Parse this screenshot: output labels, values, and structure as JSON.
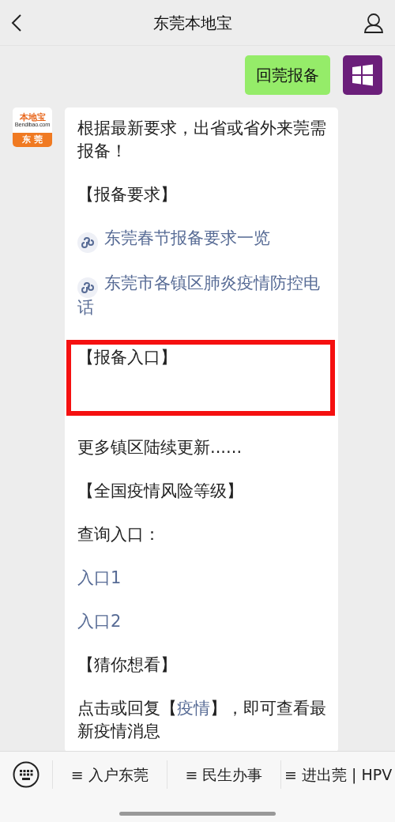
{
  "header": {
    "title": "东莞本地宝"
  },
  "outgoing_message": {
    "text": "回莞报备"
  },
  "incoming_message": {
    "avatar": {
      "brand": "本地宝",
      "site": "Bendibao.com",
      "city": "东 莞"
    },
    "blocks": [
      {
        "kind": "text",
        "parts": [
          {
            "text": "根据最新要求，出省或省外来莞需报备！",
            "link": false
          }
        ]
      },
      {
        "kind": "text",
        "parts": [
          {
            "text": "【报备要求】",
            "link": false
          }
        ]
      },
      {
        "kind": "miniprogram",
        "text": "东莞春节报备要求一览"
      },
      {
        "kind": "miniprogram",
        "text": "东莞市各镇区肺炎疫情防控电话"
      },
      {
        "kind": "boxed",
        "heading": "【报备入口】"
      },
      {
        "kind": "text",
        "parts": [
          {
            "text": "更多镇区陆续更新......",
            "link": false
          }
        ]
      },
      {
        "kind": "text",
        "parts": [
          {
            "text": "【全国疫情风险等级】",
            "link": false
          }
        ]
      },
      {
        "kind": "text",
        "parts": [
          {
            "text": "查询入口：",
            "link": false
          }
        ]
      },
      {
        "kind": "text",
        "parts": [
          {
            "text": "入口1",
            "link": true
          }
        ]
      },
      {
        "kind": "text",
        "parts": [
          {
            "text": "入口2",
            "link": true
          }
        ]
      },
      {
        "kind": "text",
        "parts": [
          {
            "text": "【猜你想看】",
            "link": false
          }
        ]
      },
      {
        "kind": "text",
        "parts": [
          {
            "text": "点击或回复【",
            "link": false
          },
          {
            "text": "疫情",
            "link": true
          },
          {
            "text": "】，即可查看最新疫情消息",
            "link": false
          }
        ]
      }
    ]
  },
  "bottom_menu": {
    "items": [
      {
        "text": "≡ 入户东莞"
      },
      {
        "text": "≡ 民生办事"
      },
      {
        "text": "≡ 进出莞 | HPV"
      }
    ]
  }
}
